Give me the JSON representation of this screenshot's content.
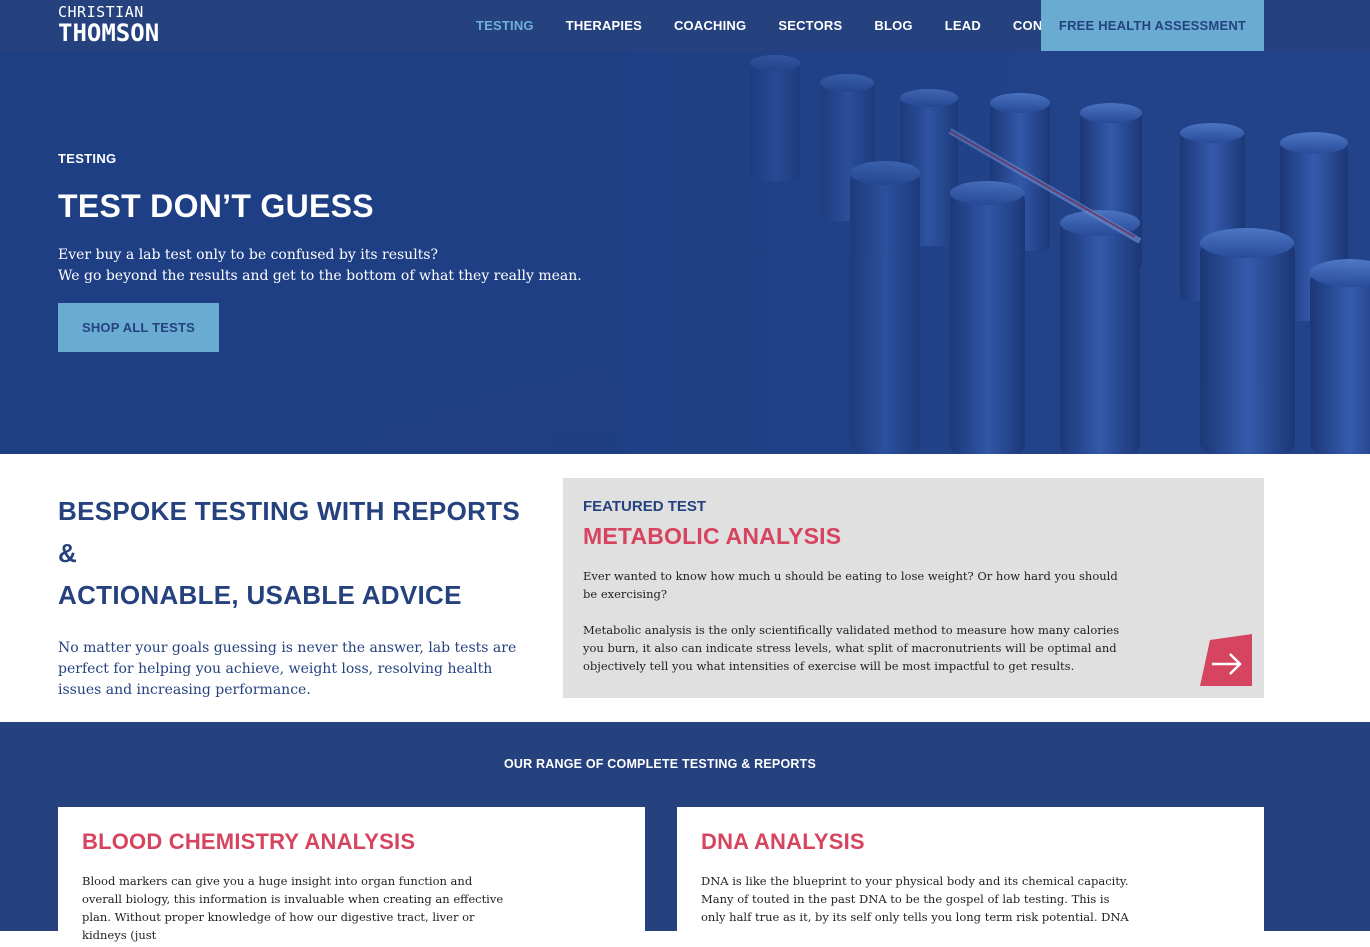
{
  "brand": {
    "line1": "CHRISTIAN",
    "line2": "THOMSON"
  },
  "nav": {
    "items": [
      "TESTING",
      "THERAPIES",
      "COACHING",
      "SECTORS",
      "BLOG",
      "LEAD",
      "CONTACT"
    ],
    "active": "TESTING",
    "cta": "FREE HEALTH ASSESSMENT"
  },
  "hero": {
    "eyebrow": "TESTING",
    "title": "TEST DON’T GUESS",
    "line1": "Ever buy a lab test only to be confused by its results?",
    "line2": "We go beyond the results and get to the bottom of what they really mean.",
    "button": "SHOP ALL TESTS"
  },
  "intro": {
    "title_line1": "BESPOKE TESTING WITH REPORTS &",
    "title_line2": "ACTIONABLE, USABLE ADVICE",
    "text": "No matter your goals guessing is never the answer, lab tests are perfect for helping you achieve, weight loss, resolving health issues and increasing performance."
  },
  "featured": {
    "eyebrow": "FEATURED TEST",
    "title": "METABOLIC ANALYSIS",
    "para1": "Ever wanted to know how much u should be eating to lose weight? Or how hard you should be exercising?",
    "para2": "Metabolic analysis is the only scientifically validated method to measure how many calories you burn, it also can indicate stress levels, what split of macronutrients will be optimal and objectively tell you what intensities of exercise will be most impactful to get results.",
    "arrow_icon": "arrow-right-icon"
  },
  "range": {
    "title": "OUR RANGE OF COMPLETE TESTING & REPORTS",
    "cards": [
      {
        "title": "BLOOD CHEMISTRY ANALYSIS",
        "text": "Blood markers can give you a huge insight into organ function and overall biology, this information is invaluable when creating an effective plan. Without proper knowledge of how our digestive tract, liver or kidneys (just"
      },
      {
        "title": "DNA ANALYSIS",
        "text": "DNA is like the blueprint to your physical body and its chemical capacity. Many of touted in the past DNA to be the gospel of lab testing. This is only half true as it, by its self only tells you long term risk potential. DNA"
      }
    ]
  },
  "colors": {
    "navy": "#25427f",
    "accent_blue": "#6aabd2",
    "accent_red": "#d6445f",
    "panel_grey": "#e0e0e0"
  }
}
